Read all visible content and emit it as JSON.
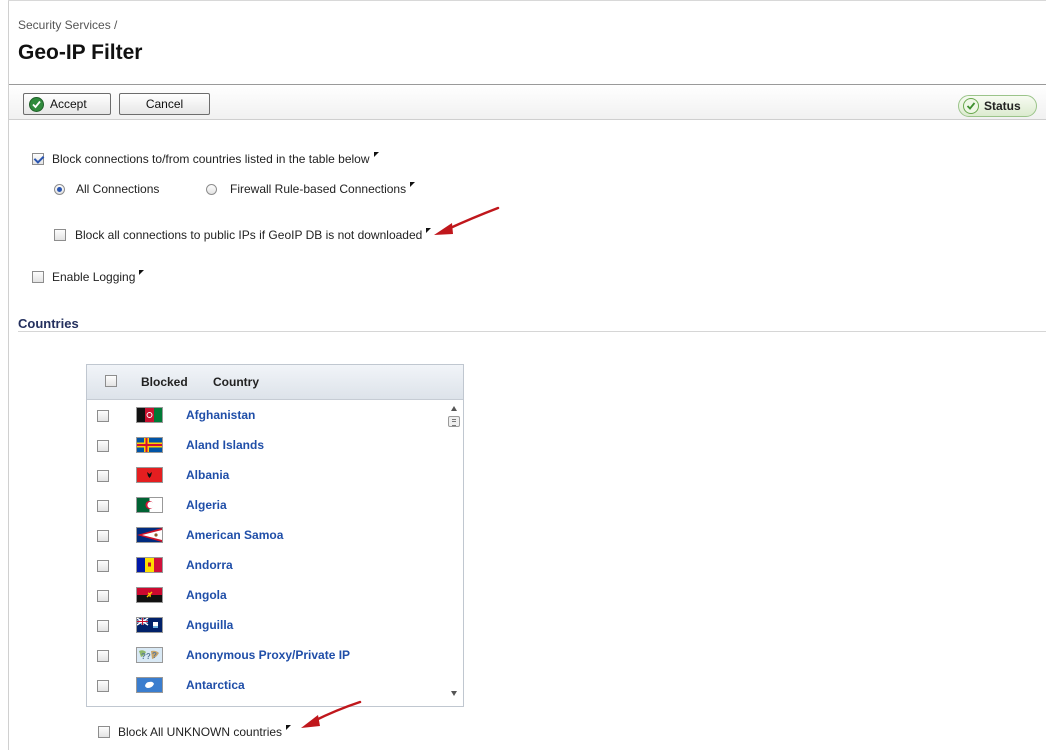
{
  "breadcrumb": "Security Services /",
  "page_title": "Geo-IP Filter",
  "toolbar": {
    "accept_label": "Accept",
    "cancel_label": "Cancel",
    "status_label": "Status"
  },
  "options": {
    "block_connections": {
      "label": "Block connections to/from countries listed in the table below",
      "checked": true
    },
    "all_connections": {
      "label": "All Connections",
      "selected": true
    },
    "firewall_rule_connections": {
      "label": "Firewall Rule-based Connections",
      "selected": false
    },
    "block_public_ips": {
      "label": "Block all connections to public IPs if GeoIP DB is not downloaded",
      "checked": false
    },
    "enable_logging": {
      "label": "Enable Logging",
      "checked": false
    }
  },
  "countries_section": {
    "title": "Countries",
    "headers": {
      "blocked": "Blocked",
      "country": "Country"
    },
    "rows": [
      {
        "name": "Afghanistan",
        "blocked": false,
        "flag": "afghanistan-flag-icon"
      },
      {
        "name": "Aland Islands",
        "blocked": false,
        "flag": "aland-islands-flag-icon"
      },
      {
        "name": "Albania",
        "blocked": false,
        "flag": "albania-flag-icon"
      },
      {
        "name": "Algeria",
        "blocked": false,
        "flag": "algeria-flag-icon"
      },
      {
        "name": "American Samoa",
        "blocked": false,
        "flag": "american-samoa-flag-icon"
      },
      {
        "name": "Andorra",
        "blocked": false,
        "flag": "andorra-flag-icon"
      },
      {
        "name": "Angola",
        "blocked": false,
        "flag": "angola-flag-icon"
      },
      {
        "name": "Anguilla",
        "blocked": false,
        "flag": "anguilla-flag-icon"
      },
      {
        "name": "Anonymous Proxy/Private IP",
        "blocked": false,
        "flag": "anonymous-proxy-flag-icon"
      },
      {
        "name": "Antarctica",
        "blocked": false,
        "flag": "antarctica-flag-icon"
      }
    ]
  },
  "block_unknown": {
    "label": "Block All UNKNOWN countries",
    "checked": false
  },
  "colors": {
    "link": "#1f4ea8",
    "section_title": "#24305e",
    "annotation_arrow": "#c0171c",
    "accept_icon": "#2f8a3c"
  }
}
